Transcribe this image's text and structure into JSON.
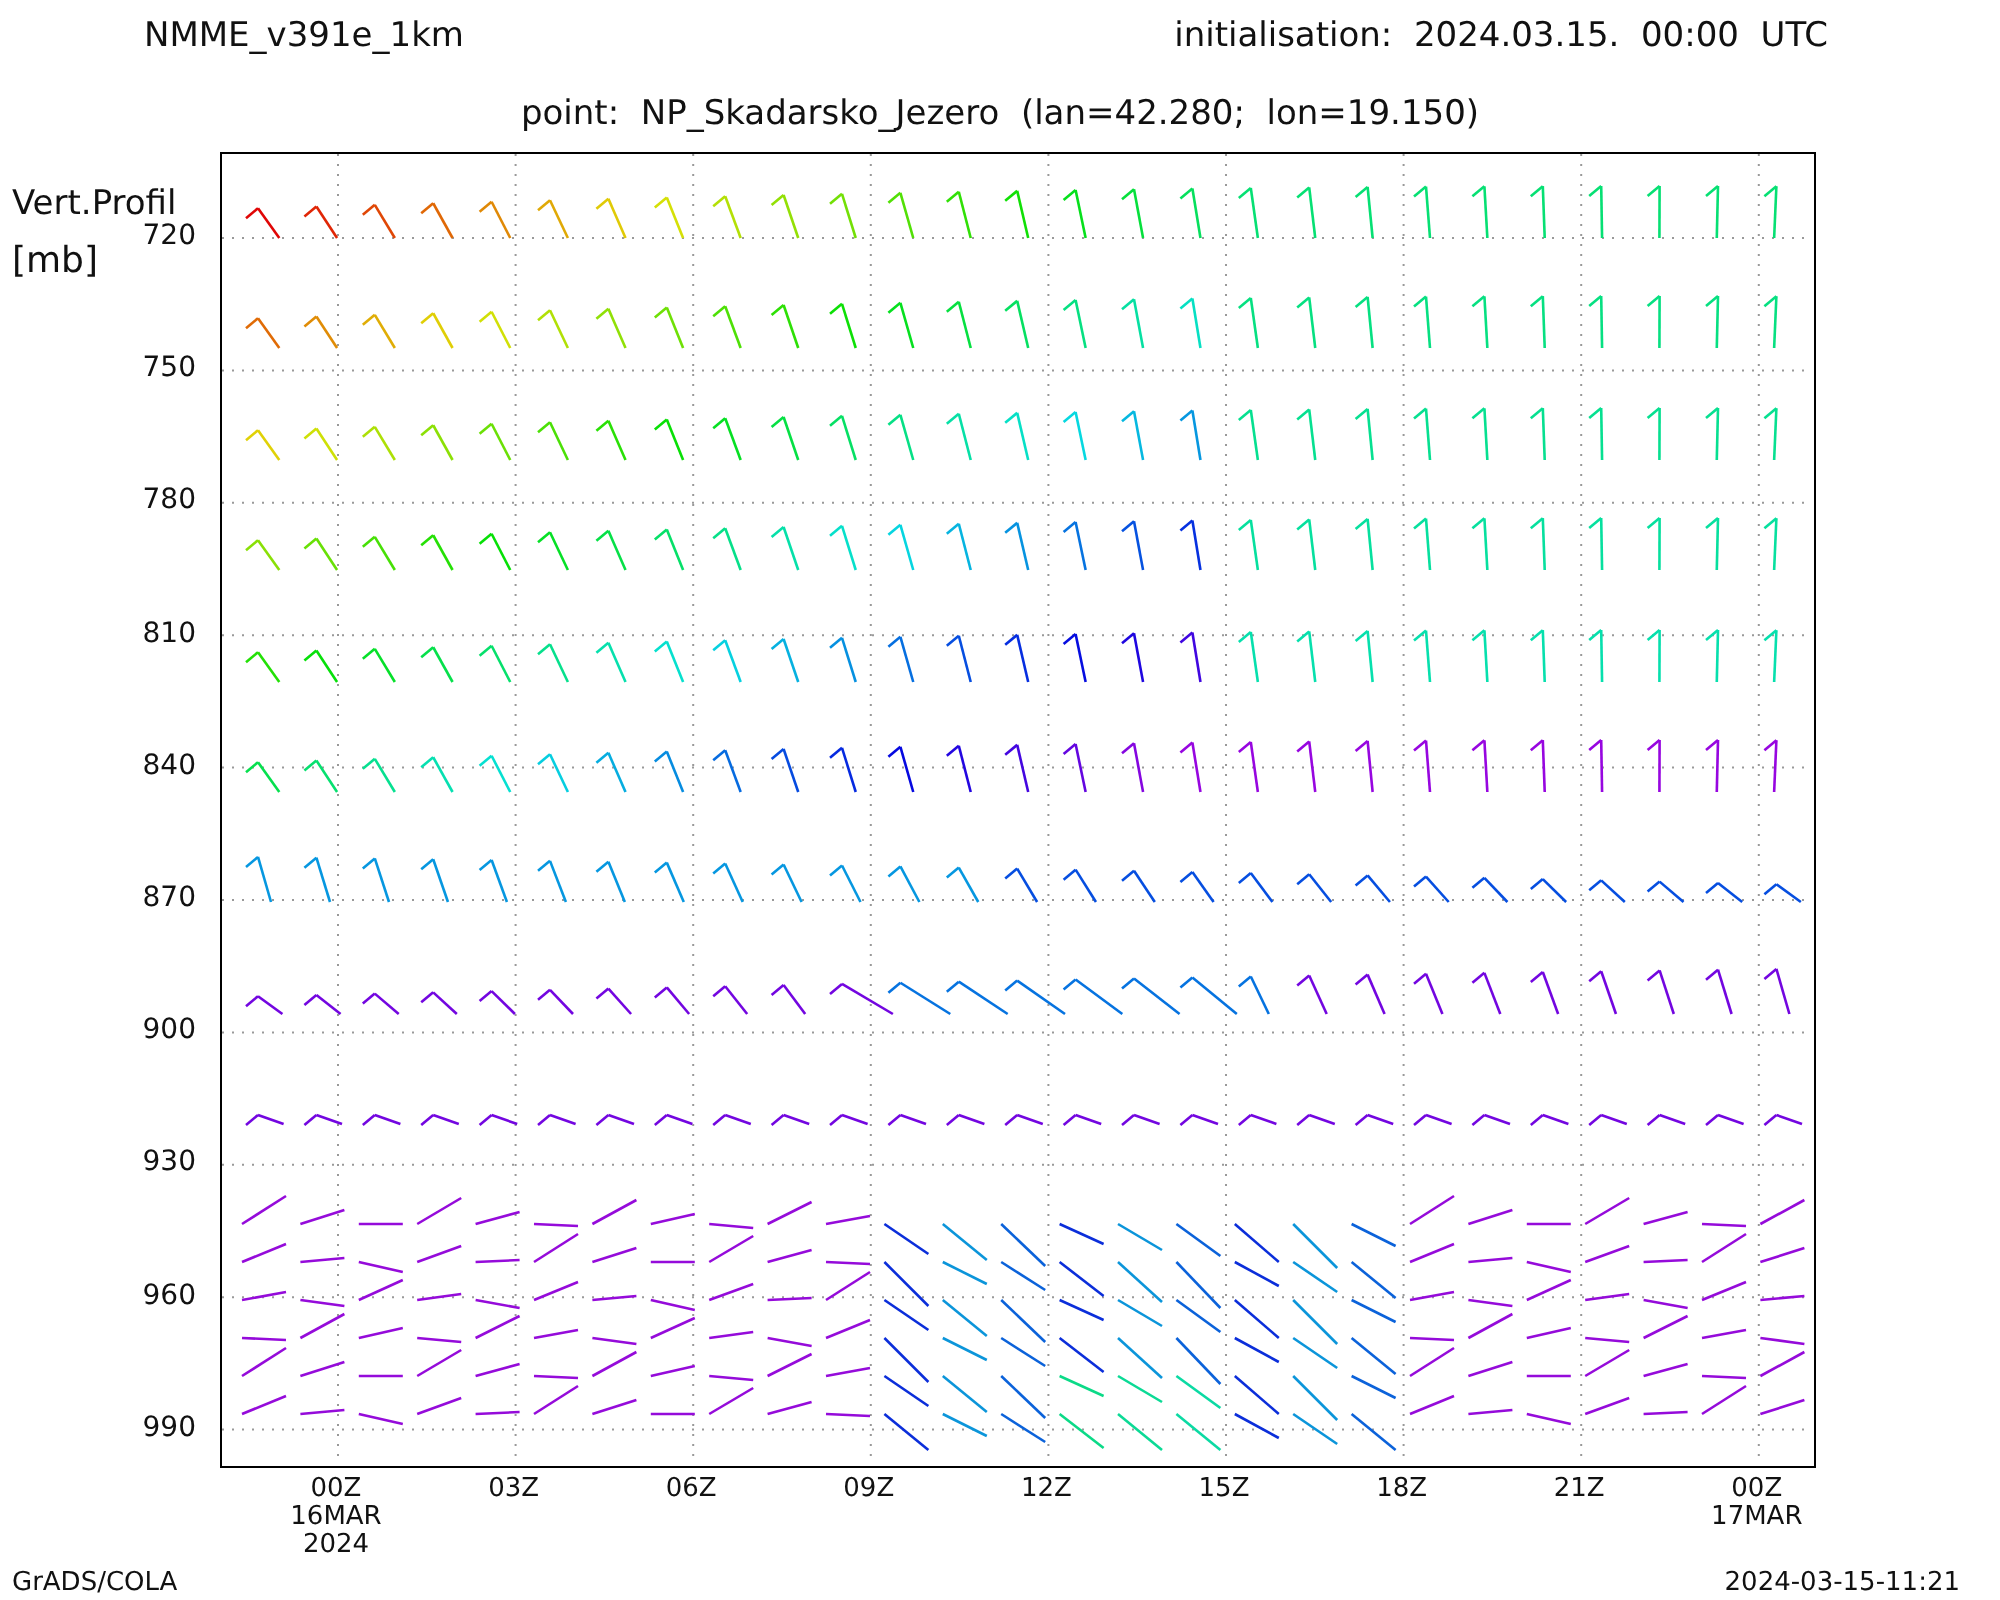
{
  "header": {
    "model": "NMME_v391e_1km",
    "initialisation": "initialisation:  2024.03.15.  00:00  UTC",
    "point": "point:  NP_Skadarsko_Jezero  (lan=42.280;  lon=19.150)"
  },
  "y_axis": {
    "title": "Vert.Profil",
    "unit": "[mb]",
    "ticks": [
      "720",
      "750",
      "780",
      "810",
      "840",
      "870",
      "900",
      "930",
      "960",
      "990"
    ]
  },
  "x_axis": {
    "ticks": [
      {
        "lines": [
          "00Z",
          "16MAR",
          "2024"
        ]
      },
      {
        "lines": [
          "03Z"
        ]
      },
      {
        "lines": [
          "06Z"
        ]
      },
      {
        "lines": [
          "09Z"
        ]
      },
      {
        "lines": [
          "12Z"
        ]
      },
      {
        "lines": [
          "15Z"
        ]
      },
      {
        "lines": [
          "18Z"
        ]
      },
      {
        "lines": [
          "21Z"
        ]
      },
      {
        "lines": [
          "00Z",
          "17MAR"
        ]
      }
    ]
  },
  "footer": {
    "left": "GrADS/COLA",
    "right": "2024-03-15-11:21"
  }
}
